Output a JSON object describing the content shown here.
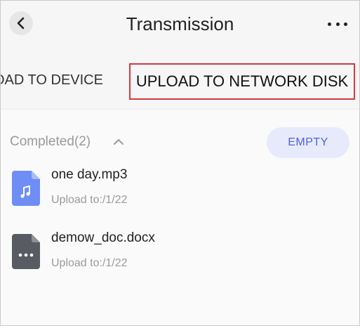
{
  "header": {
    "title": "Transmission"
  },
  "tabs": {
    "left_label": "OAD TO DEVICE",
    "right_label": "UPLOAD TO NETWORK DISK"
  },
  "section": {
    "title": "Completed(2)",
    "empty_label": "EMPTY"
  },
  "files": [
    {
      "name": "one day.mp3",
      "subtitle": "Upload to:/1/22",
      "icon": "audio-file-icon"
    },
    {
      "name": "demow_doc.docx",
      "subtitle": "Upload to:/1/22",
      "icon": "document-file-icon"
    }
  ],
  "colors": {
    "accent": "#4d61d8",
    "empty_button_bg": "#e7eafa",
    "highlight_border": "#d9363e",
    "audio_icon": "#6e8df5",
    "doc_icon": "#595b63"
  }
}
